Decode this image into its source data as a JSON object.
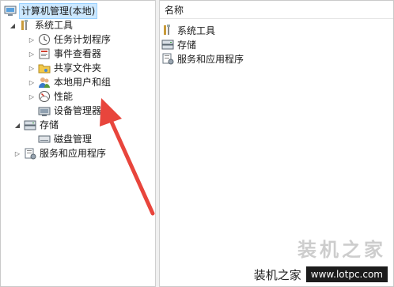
{
  "tree": {
    "root": {
      "label": "计算机管理(本地)",
      "icon": "computer-management-icon"
    },
    "system_tools": {
      "label": "系统工具",
      "icon": "tools-icon"
    },
    "task_scheduler": {
      "label": "任务计划程序",
      "icon": "clock-icon"
    },
    "event_viewer": {
      "label": "事件查看器",
      "icon": "event-log-icon"
    },
    "shared_folders": {
      "label": "共享文件夹",
      "icon": "shared-folder-icon"
    },
    "local_users": {
      "label": "本地用户和组",
      "icon": "users-icon"
    },
    "performance": {
      "label": "性能",
      "icon": "performance-icon"
    },
    "device_manager": {
      "label": "设备管理器",
      "icon": "device-manager-icon"
    },
    "storage": {
      "label": "存储",
      "icon": "storage-icon"
    },
    "disk_management": {
      "label": "磁盘管理",
      "icon": "disk-icon"
    },
    "services": {
      "label": "服务和应用程序",
      "icon": "services-icon"
    }
  },
  "list": {
    "header": "名称",
    "items": [
      {
        "label": "系统工具",
        "icon": "tools-icon"
      },
      {
        "label": "存储",
        "icon": "storage-icon"
      },
      {
        "label": "服务和应用程序",
        "icon": "services-icon"
      }
    ]
  },
  "watermark": {
    "big": "装机之家",
    "text": "装机之家",
    "url": "www.lotpc.com"
  },
  "colors": {
    "arrow": "#e8453c",
    "selection": "#cce8ff"
  }
}
